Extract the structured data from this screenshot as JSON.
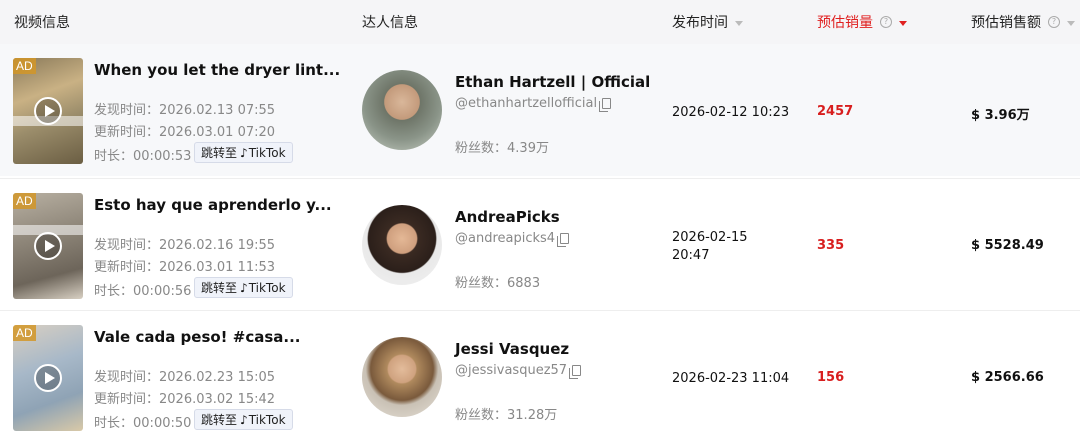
{
  "header": {
    "video_info": "视频信息",
    "creator_info": "达人信息",
    "publish_time": "发布时间",
    "est_sales": "预估销量",
    "est_gmv": "预估销售额"
  },
  "colors": {
    "accent_red": "#e02020",
    "header_bg": "#f5f5f7",
    "row_alt_bg": "#f7f8fa"
  },
  "labels": {
    "found_time": "发现时间：",
    "updated_time": "更新时间：",
    "duration": "时长：",
    "jump_to": "跳转至",
    "tiktok": "TikTok",
    "fans": "粉丝数：",
    "ad": "AD"
  },
  "rows": [
    {
      "title": "When you let the dryer lint...",
      "found": "2026.02.13 07:55",
      "updated": "2026.03.01 07:20",
      "duration": "00:00:53",
      "creator_name": "Ethan Hartzell | Official",
      "handle": "@ethanhartzellofficial",
      "fans": "4.39万",
      "publish_time": "2026-02-12 10:23",
      "sales": "2457",
      "gmv": "$ 3.96万"
    },
    {
      "title": "Esto hay que aprenderlo y...",
      "found": "2026.02.16 19:55",
      "updated": "2026.03.01 11:53",
      "duration": "00:00:56",
      "creator_name": "AndreaPicks",
      "handle": "@andreapicks4",
      "fans": "6883",
      "publish_time_line1": "2026-02-15",
      "publish_time_line2": "20:47",
      "sales": "335",
      "gmv": "$ 5528.49"
    },
    {
      "title": "Vale cada peso! #casa...",
      "found": "2026.02.23 15:05",
      "updated": "2026.03.02 15:42",
      "duration": "00:00:50",
      "creator_name": "Jessi Vasquez",
      "handle": "@jessivasquez57",
      "fans": "31.28万",
      "publish_time": "2026-02-23 11:04",
      "sales": "156",
      "gmv": "$ 2566.66"
    }
  ]
}
